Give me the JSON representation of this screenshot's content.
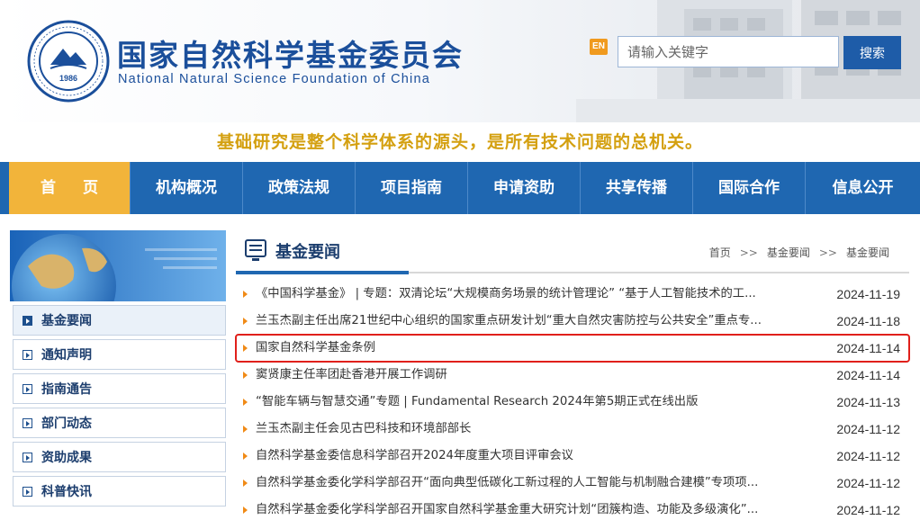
{
  "header": {
    "title_cn": "国家自然科学基金委员会",
    "title_en": "National Natural Science Foundation of China",
    "logo_year": "1986",
    "en_badge": "EN",
    "search": {
      "placeholder": "请输入关键字",
      "button": "搜索"
    }
  },
  "slogan": "基础研究是整个科学体系的源头，是所有技术问题的总机关。",
  "nav": [
    "首 页",
    "机构概况",
    "政策法规",
    "项目指南",
    "申请资助",
    "共享传播",
    "国际合作",
    "信息公开"
  ],
  "sidebar": {
    "items": [
      {
        "label": "基金要闻",
        "active": true
      },
      {
        "label": "通知声明",
        "active": false
      },
      {
        "label": "指南通告",
        "active": false
      },
      {
        "label": "部门动态",
        "active": false
      },
      {
        "label": "资助成果",
        "active": false
      },
      {
        "label": "科普快讯",
        "active": false
      }
    ]
  },
  "main": {
    "title": "基金要闻",
    "breadcrumb": [
      "首页",
      "基金要闻",
      "基金要闻"
    ],
    "breadcrumb_sep": ">>",
    "news": [
      {
        "title": "《中国科学基金》 | 专题：双清论坛“大规模商务场景的统计管理论” “基于人工智能技术的工...",
        "date": "2024-11-19"
      },
      {
        "title": "兰玉杰副主任出席21世纪中心组织的国家重点研发计划“重大自然灾害防控与公共安全”重点专...",
        "date": "2024-11-18"
      },
      {
        "title": "国家自然科学基金条例",
        "date": "2024-11-14",
        "highlighted": true
      },
      {
        "title": "窦贤康主任率团赴香港开展工作调研",
        "date": "2024-11-14"
      },
      {
        "title": "“智能车辆与智慧交通”专题 | Fundamental Research 2024年第5期正式在线出版",
        "date": "2024-11-13"
      },
      {
        "title": "兰玉杰副主任会见古巴科技和环境部部长",
        "date": "2024-11-12"
      },
      {
        "title": "自然科学基金委信息科学部召开2024年度重大项目评审会议",
        "date": "2024-11-12"
      },
      {
        "title": "自然科学基金委化学科学部召开“面向典型低碳化工新过程的人工智能与机制融合建模”专项项...",
        "date": "2024-11-12"
      },
      {
        "title": "自然科学基金委化学科学部召开国家自然科学基金重大研究计划“团簇构造、功能及多级演化”...",
        "date": "2024-11-12"
      }
    ]
  },
  "colors": {
    "brand_blue": "#1f67b1",
    "title_blue": "#1b4f9b",
    "active_nav": "#f2b43a",
    "slogan_gold": "#d4a010",
    "bullet_orange": "#f08a16",
    "highlight_red": "#e0201b"
  }
}
